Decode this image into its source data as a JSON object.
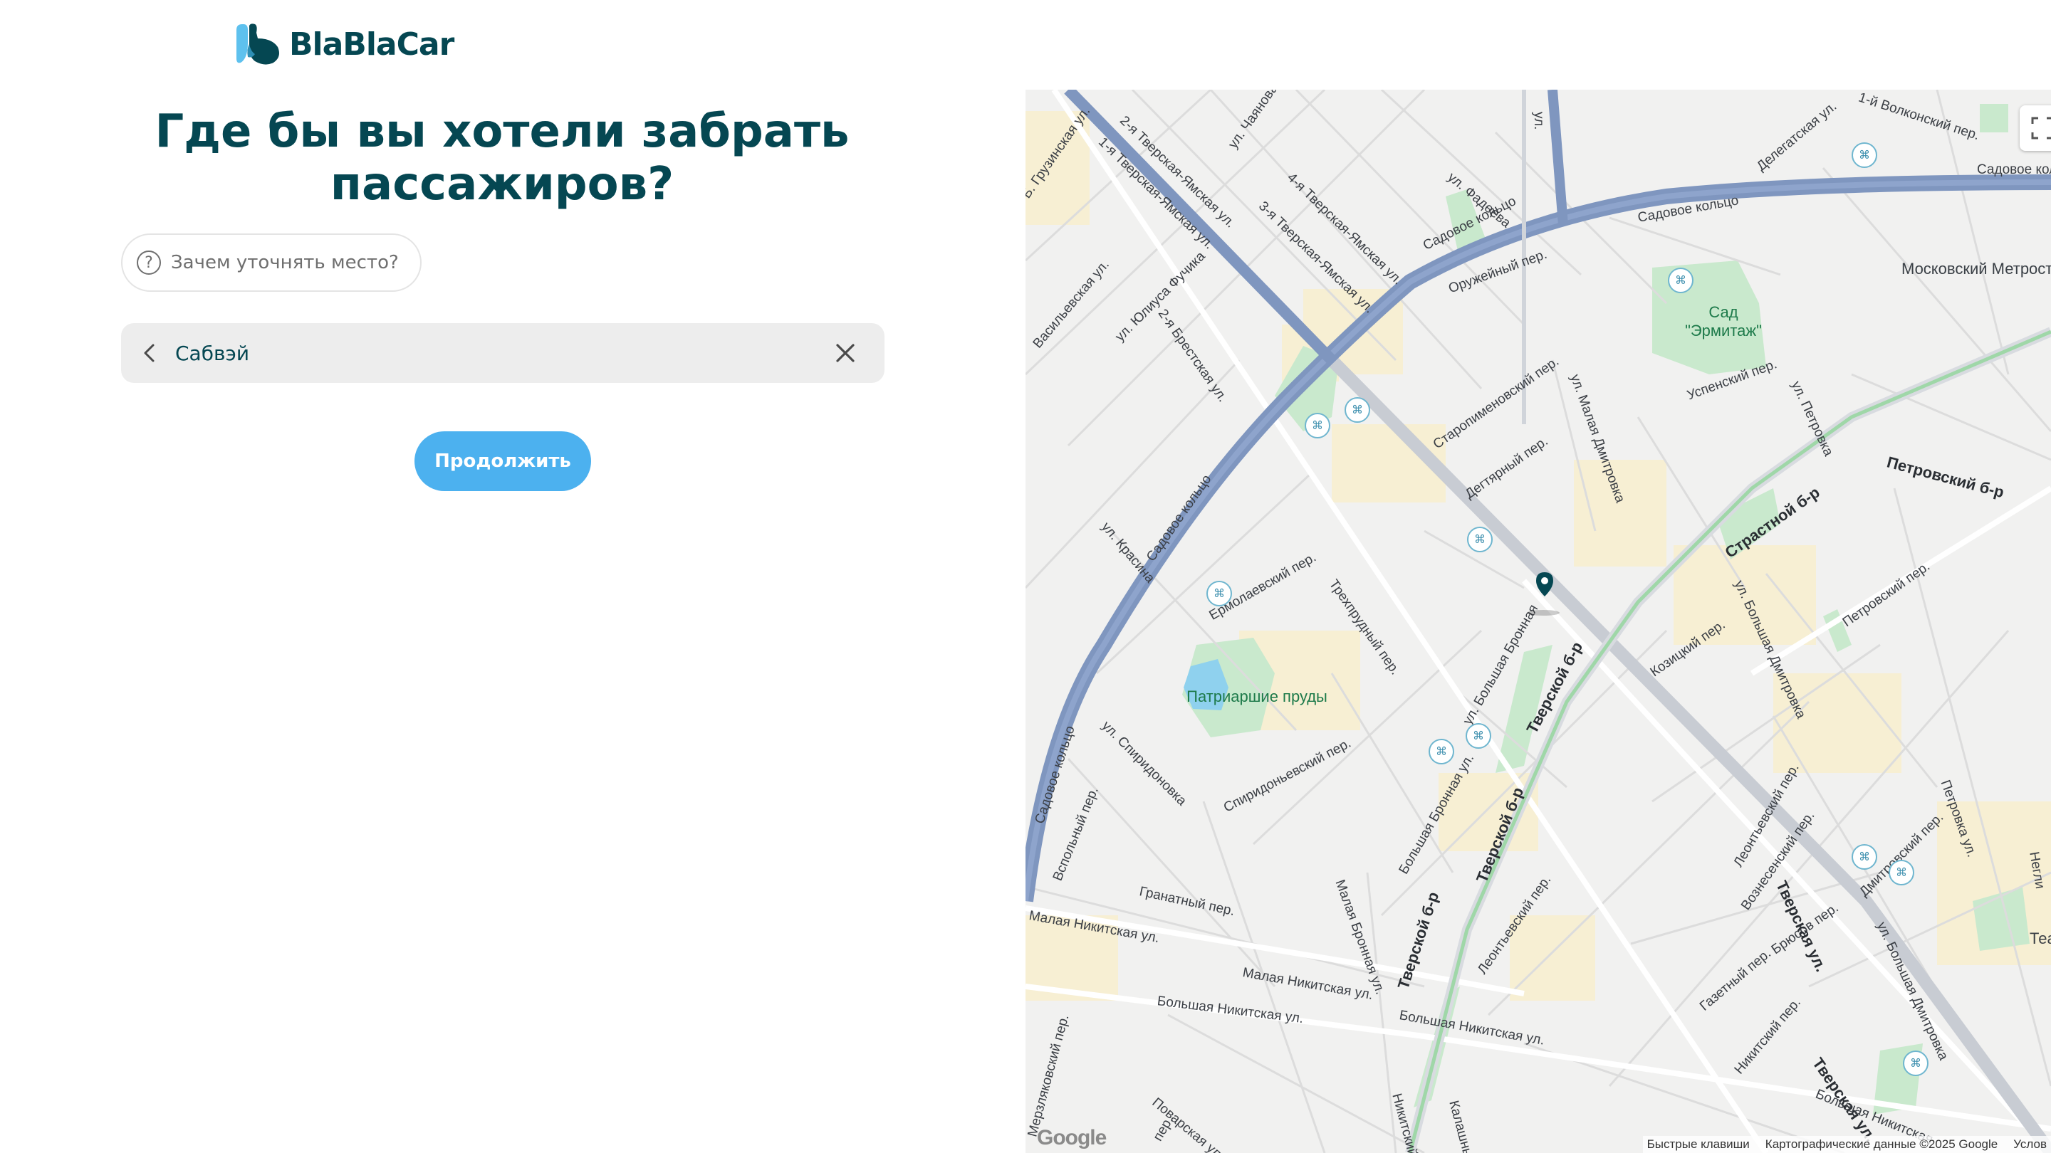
{
  "brand": {
    "name": "BlaBlaCar",
    "colors": {
      "primary": "#054752",
      "accent": "#4cb1ef",
      "logo_light": "#5ec1ee"
    }
  },
  "page": {
    "title": "Где бы вы хотели забрать пассажиров?"
  },
  "why_button": {
    "label": "Зачем уточнять место?",
    "icon": "question-circle-icon"
  },
  "search": {
    "value": "Сабвэй",
    "back_icon": "chevron-left-icon",
    "clear_icon": "close-icon"
  },
  "continue_button": {
    "label": "Продолжить"
  },
  "map": {
    "labels": {
      "sadovoe1": "Садовое кольцо",
      "sadovoe2": "Садовое кольцо",
      "sadovoe3": "Садовое кольцо",
      "sadovoe4": "Садовое кольцо",
      "sadovoe5": "Садовое кольцо",
      "tver_yam": "1-я Тверская-Ямская ул.",
      "tver_yam2": "2-я Тверская-Ямская ул.",
      "tver_yam3": "3-я Тверская-Ямская ул.",
      "tver_yam4": "4-я Тверская-Ямская ул.",
      "chayanova": "ул. Чаянова",
      "gruzinskaya": "Б. Грузинская ул.",
      "vasilevskaya": "Васильевская ул.",
      "fuchika": "ул. Юлиуса Фучика",
      "brestskaya": "2-я Брестская ул.",
      "fadeeva": "ул. Фадеева",
      "oruzheyny": "Оружейный пер.",
      "delegatskaya": "Делегатская ул.",
      "volkonsky": "1-й Волконский пер.",
      "metrostroy": "Московский Метрострой",
      "sad_ermitazh": "Сад \"Эрмитаж\"",
      "uspensky": "Успенский пер.",
      "petrovka": "ул. Петровка",
      "petrovsky_bul": "Петровский б-р",
      "staropimen": "Старопименовский пер.",
      "degtyarny": "Дегтярный пер.",
      "m_dmitrovka": "ул. Малая Дмитровка",
      "krasina": "ул. Красина",
      "ermolaevsky": "Ермолаевский пер.",
      "trekhprudny": "Трехпрудный пер.",
      "strastnoy": "Страстной б-р",
      "b_dmitrovka": "ул. Большая Дмитровка",
      "petrovsky_per": "Петровский пер.",
      "kozitsky": "Козицкий пер.",
      "b_bronnaya": "ул. Большая Бронная",
      "tverskoy_bul": "Тверской б-р",
      "tverskoy_bul2": "Тверской б-р",
      "tverskoy_bul3": "Тверской б-р",
      "patriarshie": "Патриаршие пруды",
      "spiridonovka": "ул. Спиридоновка",
      "spiridonievsky": "Спиридоньевский пер.",
      "vspolny": "Вспольный пер.",
      "m_bronnaya": "Малая Бронная ул.",
      "b_bronnaya2": "Большая Бронная ул.",
      "leontievsky": "Леонтьевский пер.",
      "leontievsky2": "Леонтьевский пер.",
      "voznesensky": "Вознесенский пер.",
      "bryusov": "Брюсов пер.",
      "tverskaya": "Тверская ул.",
      "tverskaya2": "Тверская ул.",
      "dmitrovsky": "Дмитровский пер.",
      "petrovka2": "Петровка ул.",
      "b_dmitrovka2": "ул. Большая Дмитровка",
      "teatr": "Театр",
      "granatny": "Гранатный пер.",
      "m_nikitskaya": "Малая Никитская ул.",
      "m_nikitskaya2": "Малая Никитская ул.",
      "b_nikitskaya": "Большая Никитская ул.",
      "b_nikitskaya2": "Большая Никитская ул.",
      "b_nikitskaya3": "Большая Никитская",
      "gazetny": "Газетный пер.",
      "nikitsky_per": "Никитский пер.",
      "nikitsky_bul": "Никитский бул.",
      "kalashny": "Калашный пер.",
      "povarskaya": "Поварская ул.",
      "merzlyakovsky": "Мерзляковский пер.",
      "nikitsky_per2": "пер.",
      "neglinnaya": "Негли",
      "sadovoe_top": "Садовое кольцо",
      "ul_top": "ул.",
      "google_logo": "Google"
    },
    "attribution": {
      "shortcuts": "Быстрые клавиши",
      "data": "Картографические данные ©2025 Google",
      "terms": "Услов"
    },
    "icons": {
      "fullscreen": "fullscreen-icon",
      "pin": "map-pin-icon",
      "metro": "metro-icon"
    }
  }
}
